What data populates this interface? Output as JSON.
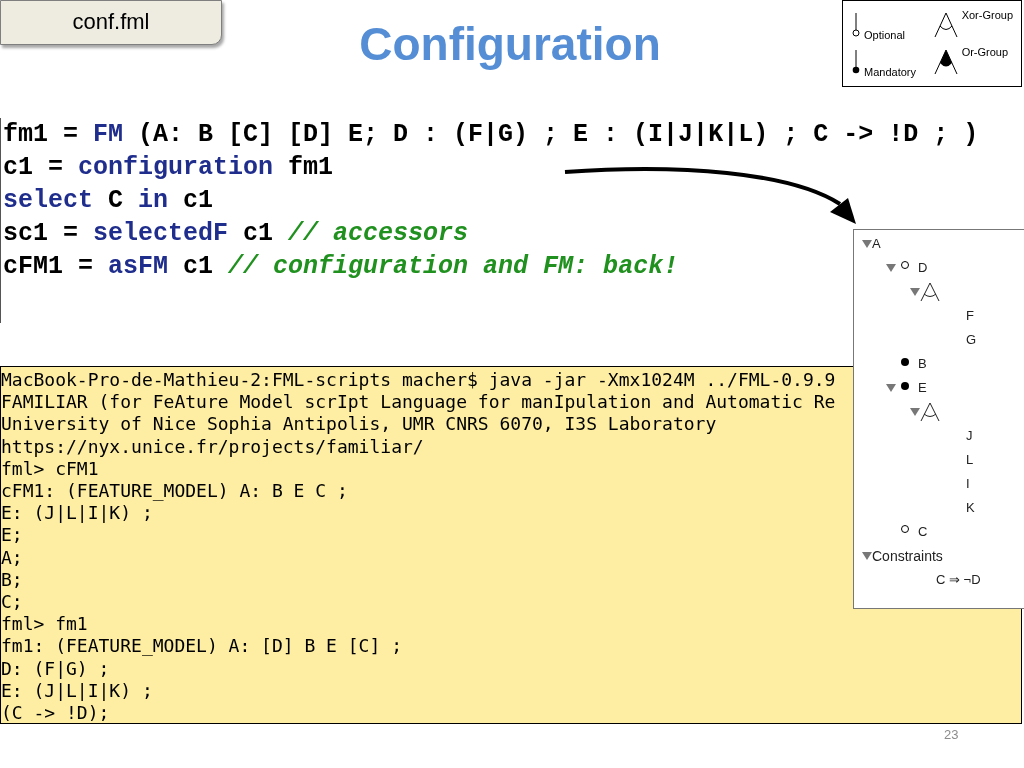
{
  "file_tab": {
    "label": "conf.fml"
  },
  "title": "Configuration",
  "legend": [
    {
      "kind": "optional",
      "label": "Optional"
    },
    {
      "kind": "mandatory",
      "label": "Mandatory"
    },
    {
      "kind": "xor",
      "label": "Xor-Group"
    },
    {
      "kind": "or",
      "label": "Or-Group"
    }
  ],
  "code_lines": [
    [
      {
        "kind": "plain",
        "text": "fm1 = "
      },
      {
        "kind": "keyword",
        "text": "FM"
      },
      {
        "kind": "plain",
        "text": " (A: B [C] [D] E; D : (F|G) ; E : (I|J|K|L) ; C -> !D ; )"
      }
    ],
    [
      {
        "kind": "plain",
        "text": "c1 = "
      },
      {
        "kind": "keyword",
        "text": "configuration"
      },
      {
        "kind": "plain",
        "text": " fm1"
      }
    ],
    [
      {
        "kind": "keyword",
        "text": "select"
      },
      {
        "kind": "plain",
        "text": " C "
      },
      {
        "kind": "keyword",
        "text": "in"
      },
      {
        "kind": "plain",
        "text": " c1"
      }
    ],
    [
      {
        "kind": "plain",
        "text": "sc1 = "
      },
      {
        "kind": "keyword",
        "text": "selectedF"
      },
      {
        "kind": "plain",
        "text": " c1 "
      },
      {
        "kind": "comment",
        "text": "// accessors"
      }
    ],
    [
      {
        "kind": "plain",
        "text": "cFM1 = "
      },
      {
        "kind": "keyword",
        "text": "asFM"
      },
      {
        "kind": "plain",
        "text": " c1 "
      },
      {
        "kind": "comment",
        "text": "// configuration and FM: back!"
      }
    ]
  ],
  "terminal_lines": [
    "MacBook-Pro-de-Mathieu-2:FML-scripts macher$ java -jar -Xmx1024M ../FML-0.9.9",
    "FAMILIAR (for FeAture Model scrIpt Language for manIpulation and Automatic Re",
    "University of Nice Sophia Antipolis, UMR CNRS 6070, I3S Laboratory",
    "https://nyx.unice.fr/projects/familiar/",
    "fml> cFM1",
    "cFM1: (FEATURE_MODEL) A: B E C ;",
    "E: (J|L|I|K) ;",
    "E;",
    "A;",
    "B;",
    "C;",
    "fml> fm1",
    "fm1: (FEATURE_MODEL) A: [D] B E [C] ;",
    "D: (F|G) ;",
    "E: (J|L|I|K) ;",
    "(C -> !D);"
  ],
  "tree": [
    {
      "kind": "feature",
      "label": "A",
      "expanded": true,
      "children": [
        {
          "kind": "feature",
          "label": "D",
          "mandatory": false,
          "expanded": true,
          "children": [
            {
              "kind": "xor-group",
              "expanded": true,
              "children": [
                {
                  "kind": "feature",
                  "label": "F"
                },
                {
                  "kind": "feature",
                  "label": "G"
                }
              ]
            }
          ]
        },
        {
          "kind": "feature",
          "label": "B",
          "mandatory": true
        },
        {
          "kind": "feature",
          "label": "E",
          "mandatory": true,
          "expanded": true,
          "children": [
            {
              "kind": "xor-group",
              "expanded": true,
              "children": [
                {
                  "kind": "feature",
                  "label": "J"
                },
                {
                  "kind": "feature",
                  "label": "L"
                },
                {
                  "kind": "feature",
                  "label": "I"
                },
                {
                  "kind": "feature",
                  "label": "K"
                }
              ]
            }
          ]
        },
        {
          "kind": "feature",
          "label": "C",
          "mandatory": false
        }
      ]
    },
    {
      "kind": "section",
      "label": "Constraints",
      "expanded": true,
      "children": [
        {
          "kind": "constraint",
          "label": "C ⇒ ¬D"
        }
      ]
    }
  ],
  "page_number": "23"
}
